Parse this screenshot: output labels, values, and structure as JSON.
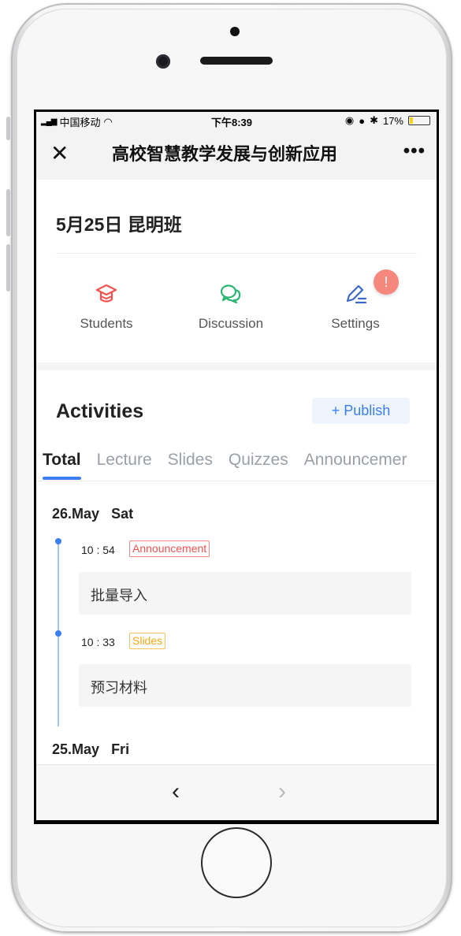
{
  "statusbar": {
    "carrier": "中国移动",
    "time": "下午8:39",
    "battery": "17%",
    "battery_level": 0.17
  },
  "nav": {
    "title": "高校智慧教学发展与创新应用",
    "close_icon": "close-icon",
    "more_icon": "more-icon"
  },
  "class_title": "5月25日 昆明班",
  "quick": {
    "students": "Students",
    "discussion": "Discussion",
    "settings": "Settings",
    "badge": "!"
  },
  "activities": {
    "title": "Activities",
    "publish_plus": "+",
    "publish": "Publish"
  },
  "tabs": [
    "Total",
    "Lecture",
    "Slides",
    "Quizzes",
    "Announcemer"
  ],
  "days": [
    {
      "date": "26.May",
      "weekday": "Sat",
      "items": [
        {
          "time": "10 : 54",
          "type": "Announcement",
          "title": "批量导入"
        },
        {
          "time": "10 : 33",
          "type": "Slides",
          "title": "预习材料"
        }
      ]
    },
    {
      "date": "25.May",
      "weekday": "Fri",
      "items": []
    }
  ],
  "colors": {
    "accent": "#3b7ef2",
    "announcement": "#ef5350",
    "slides": "#f0a718",
    "badge": "#f6877c"
  }
}
